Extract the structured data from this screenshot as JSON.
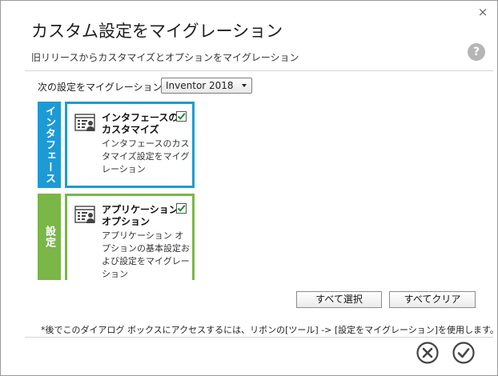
{
  "dialog": {
    "title": "カスタム設定をマイグレーション",
    "subtitle": "旧リリースからカスタマイズとオプションをマイグレーション",
    "help_label": "?",
    "close_label": "×"
  },
  "migrate": {
    "label": "次の設定をマイグレーション:",
    "selected_version": "Inventor 2018"
  },
  "sections": [
    {
      "tab_label": "インタフェース",
      "title_line1": "インタフェースの",
      "title_line2": "カスタマイズ",
      "description": "インタフェースのカスタマイズ設定をマイグレーション",
      "checked": true,
      "accent_color": "#1d9ad6",
      "icon": "user-settings-icon"
    },
    {
      "tab_label": "設定",
      "title_line1": "アプリケーション",
      "title_line2": "オプション",
      "description": "アプリケーション オプションの基本設定および設定をマイグレーション",
      "checked": true,
      "accent_color": "#7ab648",
      "icon": "user-settings-icon"
    }
  ],
  "buttons": {
    "select_all": "すべて選択",
    "clear_all": "すべてクリア"
  },
  "footnote": "*後でこのダイアログ ボックスにアクセスするには、リボンの[ツール] -> [設定をマイグレーション]を使用します。",
  "footer": {
    "cancel_icon": "x-circle-icon",
    "ok_icon": "check-circle-icon"
  }
}
